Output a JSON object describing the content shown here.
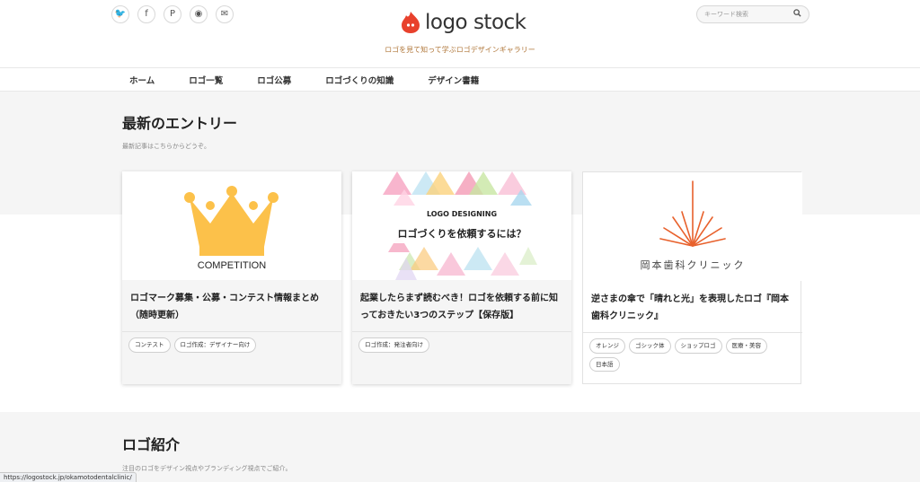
{
  "header": {
    "social_icons": [
      "twitter-icon",
      "facebook-icon",
      "pinterest-icon",
      "rss-icon",
      "mail-icon"
    ],
    "social_glyphs": [
      "🐦",
      "f",
      "P",
      "◉",
      "✉"
    ],
    "logo_text": "logo stock",
    "tagline": "ロゴを見て知って学ぶロゴデザインギャラリー",
    "search_placeholder": "キーワード検索",
    "brand_color": "#e8412c"
  },
  "nav": {
    "items": [
      "ホーム",
      "ロゴ一覧",
      "ロゴ公募",
      "ロゴづくりの知識",
      "デザイン書籍"
    ]
  },
  "latest": {
    "title": "最新のエントリー",
    "subtitle": "最新記事はこちらからどうぞ。",
    "cards": [
      {
        "thumb_text": "COMPETITION",
        "title": "ロゴマーク募集・公募・コンテスト情報まとめ（随時更新）",
        "tags": [
          "コンテスト",
          "ロゴ作成：デザイナー向け"
        ]
      },
      {
        "thumb_line1": "LOGO DESIGNING",
        "thumb_line2": "ロゴづくりを依頼するには？",
        "title": "起業したらまず読むべき！ロゴを依頼する前に知っておきたい3つのステップ【保存版】",
        "tags": [
          "ロゴ作成：発注者向け"
        ]
      },
      {
        "thumb_text": "岡本歯科クリニック",
        "title": "逆さまの傘で「晴れと光」を表現したロゴ『岡本歯科クリニック』",
        "tags": [
          "オレンジ",
          "ゴシック体",
          "ショップロゴ",
          "医療・美容",
          "日本語"
        ]
      }
    ]
  },
  "intro": {
    "title": "ロゴ紹介",
    "subtitle": "注目のロゴをデザイン視点やブランディング視点でご紹介。"
  },
  "status_url": "https://logostock.jp/okamotodentalclinic/"
}
